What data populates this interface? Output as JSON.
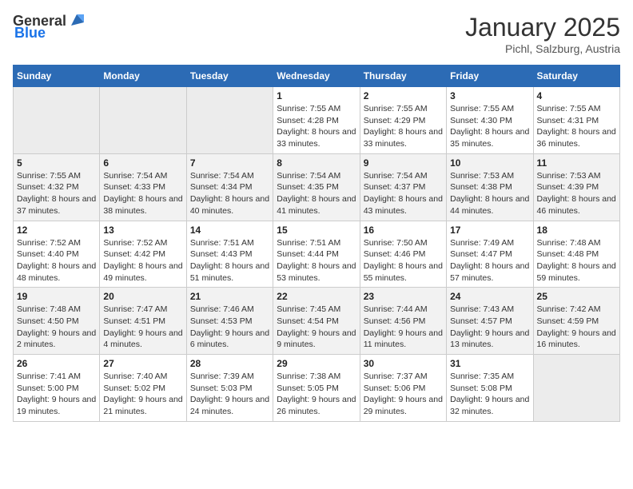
{
  "header": {
    "logo_general": "General",
    "logo_blue": "Blue",
    "title": "January 2025",
    "subtitle": "Pichl, Salzburg, Austria"
  },
  "days_of_week": [
    "Sunday",
    "Monday",
    "Tuesday",
    "Wednesday",
    "Thursday",
    "Friday",
    "Saturday"
  ],
  "weeks": [
    [
      {
        "day": "",
        "info": "",
        "empty": true
      },
      {
        "day": "",
        "info": "",
        "empty": true
      },
      {
        "day": "",
        "info": "",
        "empty": true
      },
      {
        "day": "1",
        "info": "Sunrise: 7:55 AM\nSunset: 4:28 PM\nDaylight: 8 hours and 33 minutes."
      },
      {
        "day": "2",
        "info": "Sunrise: 7:55 AM\nSunset: 4:29 PM\nDaylight: 8 hours and 33 minutes."
      },
      {
        "day": "3",
        "info": "Sunrise: 7:55 AM\nSunset: 4:30 PM\nDaylight: 8 hours and 35 minutes."
      },
      {
        "day": "4",
        "info": "Sunrise: 7:55 AM\nSunset: 4:31 PM\nDaylight: 8 hours and 36 minutes."
      }
    ],
    [
      {
        "day": "5",
        "info": "Sunrise: 7:55 AM\nSunset: 4:32 PM\nDaylight: 8 hours and 37 minutes."
      },
      {
        "day": "6",
        "info": "Sunrise: 7:54 AM\nSunset: 4:33 PM\nDaylight: 8 hours and 38 minutes."
      },
      {
        "day": "7",
        "info": "Sunrise: 7:54 AM\nSunset: 4:34 PM\nDaylight: 8 hours and 40 minutes."
      },
      {
        "day": "8",
        "info": "Sunrise: 7:54 AM\nSunset: 4:35 PM\nDaylight: 8 hours and 41 minutes."
      },
      {
        "day": "9",
        "info": "Sunrise: 7:54 AM\nSunset: 4:37 PM\nDaylight: 8 hours and 43 minutes."
      },
      {
        "day": "10",
        "info": "Sunrise: 7:53 AM\nSunset: 4:38 PM\nDaylight: 8 hours and 44 minutes."
      },
      {
        "day": "11",
        "info": "Sunrise: 7:53 AM\nSunset: 4:39 PM\nDaylight: 8 hours and 46 minutes."
      }
    ],
    [
      {
        "day": "12",
        "info": "Sunrise: 7:52 AM\nSunset: 4:40 PM\nDaylight: 8 hours and 48 minutes."
      },
      {
        "day": "13",
        "info": "Sunrise: 7:52 AM\nSunset: 4:42 PM\nDaylight: 8 hours and 49 minutes."
      },
      {
        "day": "14",
        "info": "Sunrise: 7:51 AM\nSunset: 4:43 PM\nDaylight: 8 hours and 51 minutes."
      },
      {
        "day": "15",
        "info": "Sunrise: 7:51 AM\nSunset: 4:44 PM\nDaylight: 8 hours and 53 minutes."
      },
      {
        "day": "16",
        "info": "Sunrise: 7:50 AM\nSunset: 4:46 PM\nDaylight: 8 hours and 55 minutes."
      },
      {
        "day": "17",
        "info": "Sunrise: 7:49 AM\nSunset: 4:47 PM\nDaylight: 8 hours and 57 minutes."
      },
      {
        "day": "18",
        "info": "Sunrise: 7:48 AM\nSunset: 4:48 PM\nDaylight: 8 hours and 59 minutes."
      }
    ],
    [
      {
        "day": "19",
        "info": "Sunrise: 7:48 AM\nSunset: 4:50 PM\nDaylight: 9 hours and 2 minutes."
      },
      {
        "day": "20",
        "info": "Sunrise: 7:47 AM\nSunset: 4:51 PM\nDaylight: 9 hours and 4 minutes."
      },
      {
        "day": "21",
        "info": "Sunrise: 7:46 AM\nSunset: 4:53 PM\nDaylight: 9 hours and 6 minutes."
      },
      {
        "day": "22",
        "info": "Sunrise: 7:45 AM\nSunset: 4:54 PM\nDaylight: 9 hours and 9 minutes."
      },
      {
        "day": "23",
        "info": "Sunrise: 7:44 AM\nSunset: 4:56 PM\nDaylight: 9 hours and 11 minutes."
      },
      {
        "day": "24",
        "info": "Sunrise: 7:43 AM\nSunset: 4:57 PM\nDaylight: 9 hours and 13 minutes."
      },
      {
        "day": "25",
        "info": "Sunrise: 7:42 AM\nSunset: 4:59 PM\nDaylight: 9 hours and 16 minutes."
      }
    ],
    [
      {
        "day": "26",
        "info": "Sunrise: 7:41 AM\nSunset: 5:00 PM\nDaylight: 9 hours and 19 minutes."
      },
      {
        "day": "27",
        "info": "Sunrise: 7:40 AM\nSunset: 5:02 PM\nDaylight: 9 hours and 21 minutes."
      },
      {
        "day": "28",
        "info": "Sunrise: 7:39 AM\nSunset: 5:03 PM\nDaylight: 9 hours and 24 minutes."
      },
      {
        "day": "29",
        "info": "Sunrise: 7:38 AM\nSunset: 5:05 PM\nDaylight: 9 hours and 26 minutes."
      },
      {
        "day": "30",
        "info": "Sunrise: 7:37 AM\nSunset: 5:06 PM\nDaylight: 9 hours and 29 minutes."
      },
      {
        "day": "31",
        "info": "Sunrise: 7:35 AM\nSunset: 5:08 PM\nDaylight: 9 hours and 32 minutes."
      },
      {
        "day": "",
        "info": "",
        "empty": true
      }
    ]
  ]
}
